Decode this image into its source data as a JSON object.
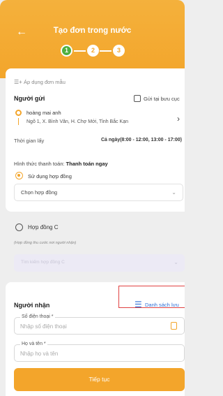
{
  "header": {
    "title": "Tạo đơn trong nước",
    "back_icon": "arrow-left-icon",
    "steps": [
      "1",
      "2",
      "3"
    ]
  },
  "sender": {
    "template_link": "Áp dụng đơn mẫu",
    "title": "Người gửi",
    "post_office_checkbox": "Gửi tại bưu cục",
    "name": "hoàng mai anh",
    "address": "Ngõ 1, X. Bình Văn, H. Chợ Mới, Tỉnh Bắc Kạn",
    "pickup_label": "Thời gian lấy",
    "pickup_value": "Cả ngày(8:00 - 12:00, 13:00 - 17:00)"
  },
  "payment": {
    "label": "Hình thức thanh toán:",
    "value": "Thanh toán ngay",
    "use_contract": "Sử dụng hợp đồng",
    "choose_contract": "Chọn hợp đồng",
    "contract_c": "Hợp đồng C",
    "contract_c_note": "(Hợp đồng thu cước nơi người nhận)",
    "disabled_select": "Tìm kiếm hợp đồng C"
  },
  "receiver": {
    "title": "Người nhận",
    "list_button": "Danh sách lưu",
    "phone_label": "Số điện thoại *",
    "phone_placeholder": "Nhập số điện thoại",
    "name_label": "Họ và tên *",
    "name_placeholder": "Nhập họ và tên"
  },
  "continue_button": "Tiếp tục",
  "colors": {
    "accent": "#f3a52b",
    "step_active": "#4fb03f",
    "highlight_border": "#e04040",
    "link": "#2f6fd6"
  }
}
